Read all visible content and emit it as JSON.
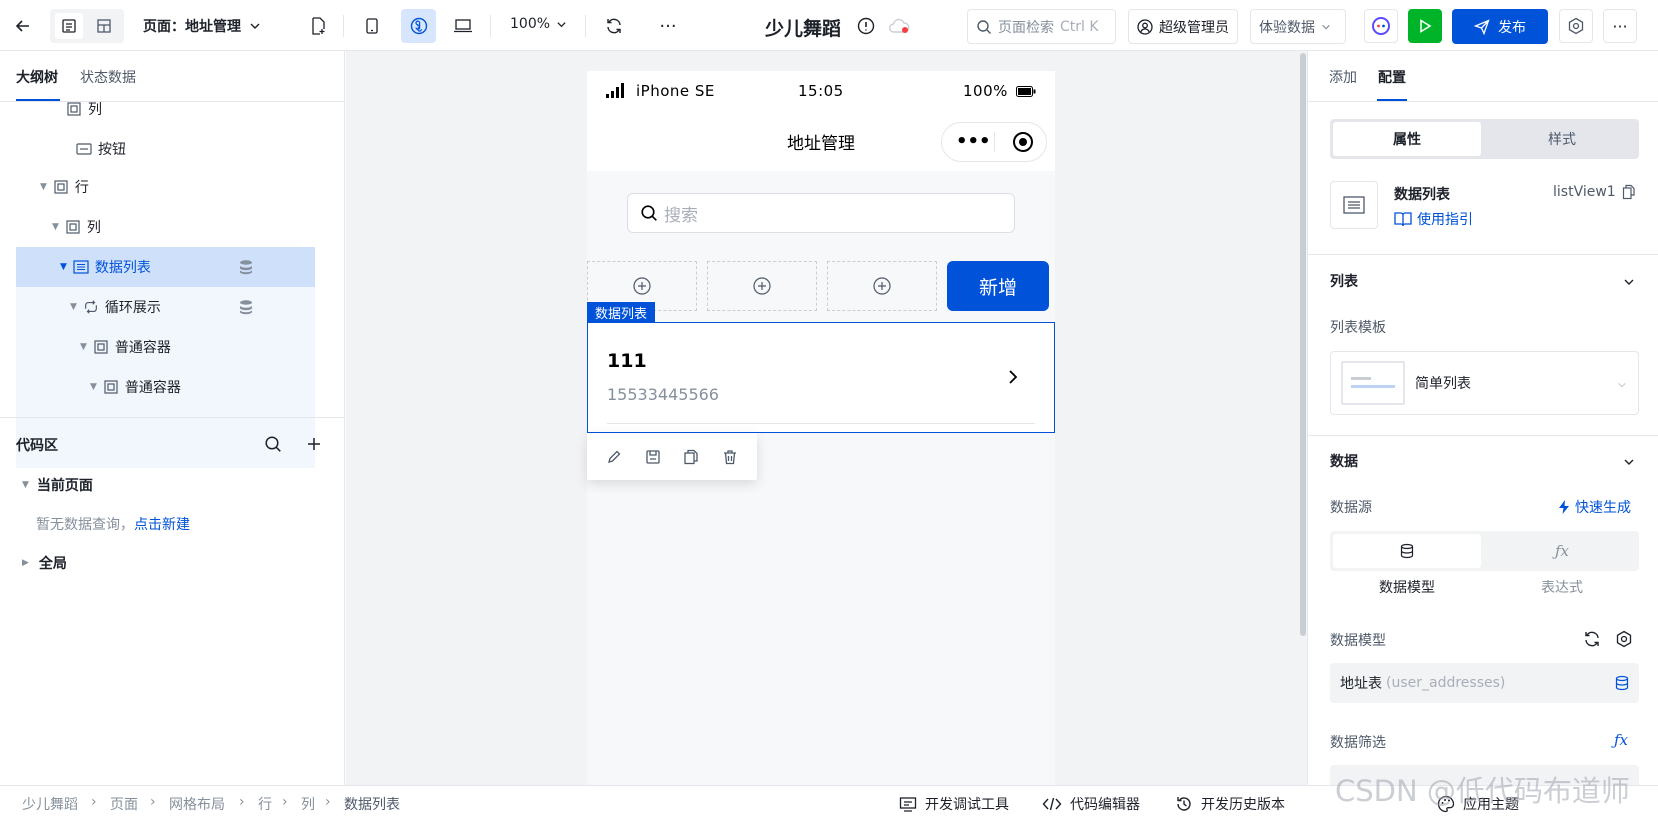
{
  "toolbar": {
    "page_label": "页面：地址管理",
    "zoom": "100%",
    "app_title": "少儿舞蹈",
    "search_placeholder": "页面检索",
    "search_shortcut": "Ctrl K",
    "user_role": "超级管理员",
    "env": "体验数据",
    "publish_label": "发布"
  },
  "left": {
    "tabs": [
      "大纲树",
      "状态数据"
    ],
    "tree": [
      {
        "label": "列"
      },
      {
        "label": "按钮"
      },
      {
        "label": "行"
      },
      {
        "label": "列"
      },
      {
        "label": "数据列表"
      },
      {
        "label": "循环展示"
      },
      {
        "label": "普通容器"
      },
      {
        "label": "普通容器"
      }
    ],
    "code": {
      "title": "代码区",
      "current_page": "当前页面",
      "empty_text": "暂无数据查询，",
      "create_link": "点击新建",
      "global": "全局"
    }
  },
  "phone": {
    "device": "iPhone SE",
    "time": "15:05",
    "battery": "100%",
    "nav_title": "地址管理",
    "search_placeholder": "搜索",
    "add_button": "新增",
    "component_tag": "数据列表",
    "item": {
      "title": "111",
      "subtitle": "15533445566"
    }
  },
  "right": {
    "tabs": [
      "添加",
      "配置"
    ],
    "seg": [
      "属性",
      "样式"
    ],
    "component": {
      "name": "数据列表",
      "id": "listView1",
      "guide": "使用指引"
    },
    "list_section": "列表",
    "list_template_label": "列表模板",
    "list_template_value": "简单列表",
    "data_section": "数据",
    "datasource_label": "数据源",
    "quick_generate": "快速生成",
    "source_tabs": [
      "数据模型",
      "表达式"
    ],
    "model_label": "数据模型",
    "model_value": "地址表",
    "model_key": "(user_addresses)",
    "filter_label": "数据筛选"
  },
  "bottom": {
    "breadcrumb": [
      "少儿舞蹈",
      "页面",
      "网格布局",
      "行",
      "列",
      "数据列表"
    ],
    "tools": [
      "开发调试工具",
      "代码编辑器",
      "开发历史版本",
      "应用主题"
    ]
  },
  "watermark": "CSDN @低代码布道师",
  "colors": {
    "primary": "#0052d9",
    "success": "#00b42a",
    "selected": "#cfe0fb"
  }
}
